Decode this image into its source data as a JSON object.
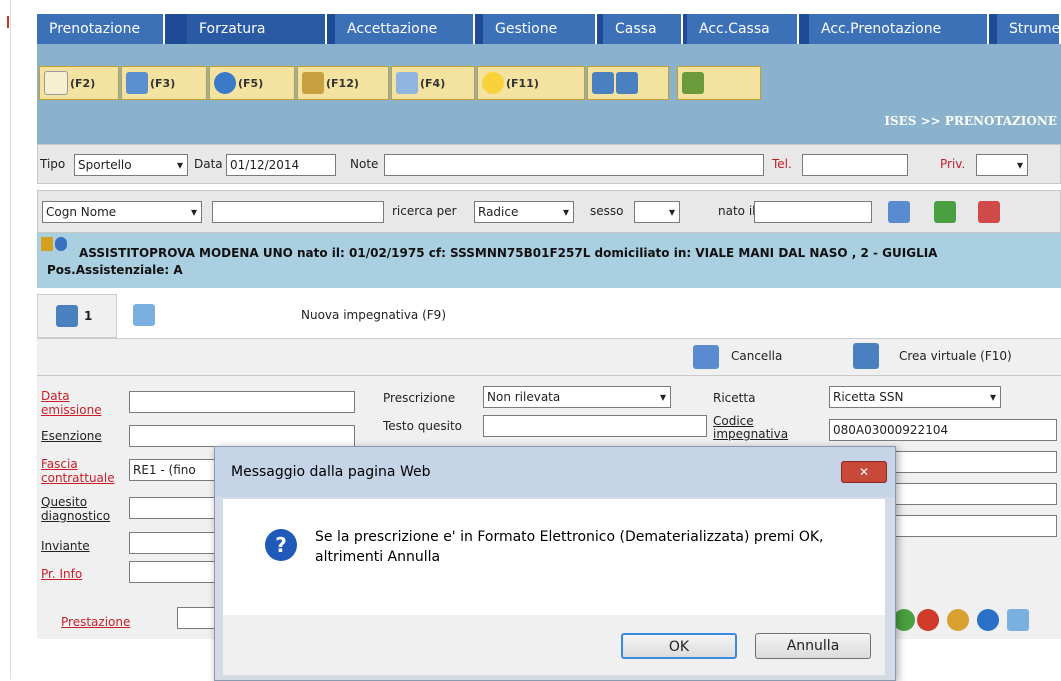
{
  "menu": {
    "tabs": [
      "Prenotazione",
      "Forzatura",
      "Accettazione",
      "Gestione",
      "Cassa",
      "Acc.Cassa",
      "Acc.Prenotazione",
      "Strume"
    ]
  },
  "toolbar": {
    "buttons": [
      "(F2)",
      "(F3)",
      "(F5)",
      "(F12)",
      "(F4)",
      "(F11)",
      "",
      ""
    ],
    "breadcrumb": "ISES >> PRENOTAZIONE"
  },
  "booking": {
    "tipo_label": "Tipo",
    "tipo_value": "Sportello",
    "data_label": "Data",
    "data_value": "01/12/2014",
    "note_label": "Note",
    "tel_label": "Tel.",
    "priv_label": "Priv."
  },
  "search": {
    "field_select": "Cogn Nome",
    "ricerca_label": "ricerca per",
    "ricerca_value": "Radice",
    "sesso_label": "sesso",
    "nato_label": "nato il"
  },
  "patient": {
    "info": "ASSISTITOPROVA MODENA UNO  nato il: 01/02/1975  cf: SSSMNN75B01F257L  domiciliato in: VIALE MANI DAL NASO , 2 - GUIGLIA Pos.Assistenziale: A"
  },
  "tabs2": {
    "count": "1",
    "new_label": "Nuova impegnativa (F9)",
    "cancel_label": "Cancella",
    "virtual_label": "Crea virtuale (F10)"
  },
  "form": {
    "data_emissione": "Data emissione",
    "esenzione": "Esenzione",
    "fascia": "Fascia contrattuale",
    "fascia_value": "RE1 - (fino",
    "quesito": "Quesito diagnostico",
    "inviante": "Inviante",
    "pr_info": "Pr. Info",
    "prescrizione_label": "Prescrizione",
    "prescrizione_value": "Non rilevata",
    "testo_quesito": "Testo quesito",
    "ricetta_label": "Ricetta",
    "ricetta_value": "Ricetta SSN",
    "codice_label": "Codice impegnativa",
    "codice_value": "080A03000922104",
    "prestazione": "Prestazione"
  },
  "dialog": {
    "title": "Messaggio dalla pagina Web",
    "message": "Se la prescrizione e' in Formato Elettronico (Dematerializzata) premi OK, altrimenti Annulla",
    "ok": "OK",
    "cancel": "Annulla"
  },
  "colors": {
    "menu_bg": "#1f4a96",
    "toolbar_bg": "#8ab2cc",
    "patient_bg": "#a9cfe0",
    "label_red": "#c8202a"
  }
}
